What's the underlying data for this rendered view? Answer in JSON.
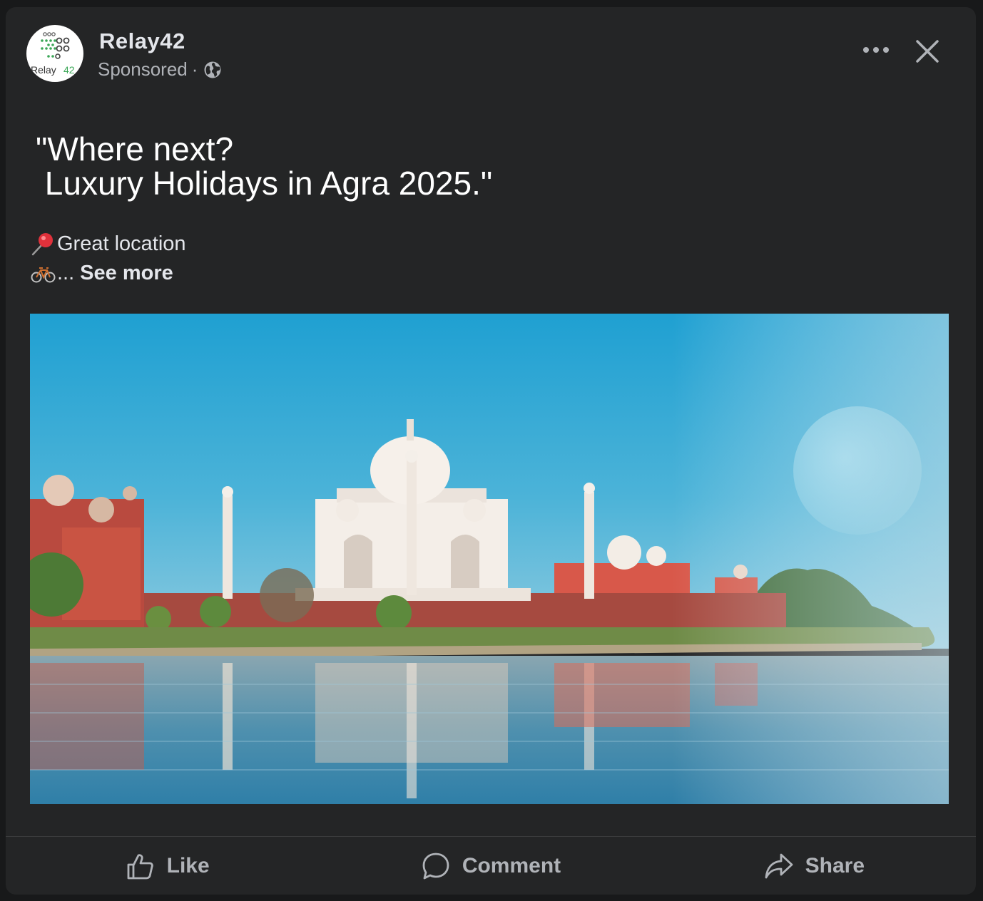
{
  "post": {
    "page_name": "Relay42",
    "sponsored_label": "Sponsored",
    "separator": "·",
    "avatar_logo_text": "Relay42",
    "headline": "\"Where next?\n Luxury Holidays in Agra 2025.\"",
    "body_line1": "Great location",
    "body_line2_ellipsis": "...",
    "see_more": "See more",
    "image_subject": "Taj Mahal by the river at sunrise with moon"
  },
  "icons": {
    "avatar": "relay42-logo",
    "audience": "globe-icon",
    "more": "more-horizontal-icon",
    "close": "close-icon",
    "pin": "round-pushpin-icon",
    "bike": "bicycle-icon",
    "like": "thumbs-up-icon",
    "comment": "comment-icon",
    "share": "share-arrow-icon"
  },
  "actions": {
    "like_label": "Like",
    "comment_label": "Comment",
    "share_label": "Share"
  },
  "colors": {
    "card_background": "#242526",
    "page_background": "#18191a",
    "primary_text": "#e4e6eb",
    "secondary_text": "#b0b3b8",
    "logo_green": "#3aa656"
  }
}
